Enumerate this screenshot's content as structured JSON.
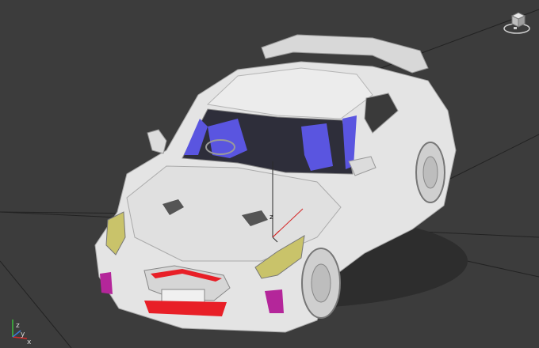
{
  "viewport": {
    "background": "#3c3c3c",
    "grid_color": "#1f1f1f",
    "view_mode": "Perspective"
  },
  "model": {
    "body_color": "#e6e6e6",
    "interior_color": "#5a55e0",
    "accent_red": "#e81f27",
    "accent_magenta": "#b4269a",
    "headlight_tint": "#c9c36a"
  },
  "gizmo": {
    "axis_x_color": "#d42a2a",
    "axis_y_color": "#2a2a2a",
    "axis_z_label": "z"
  },
  "triad": {
    "x_label": "x",
    "y_label": "y",
    "z_label": "z"
  },
  "icons": {
    "viewcube": "viewcube-icon",
    "triad": "axis-triad-icon"
  }
}
